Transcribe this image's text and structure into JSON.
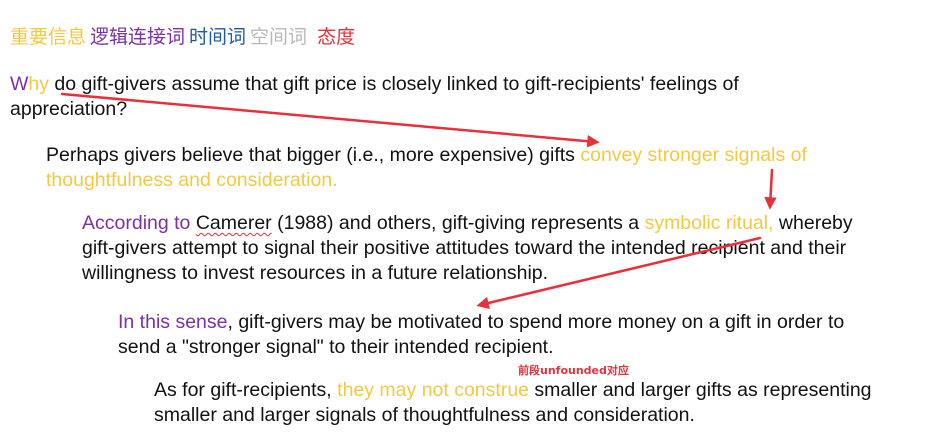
{
  "legend": {
    "important": "重要信息",
    "logic": "逻辑连接词",
    "time": "时间词",
    "empty": "空间词",
    "attitude": "态度"
  },
  "p1": {
    "w": "W",
    "hy": "hy",
    "rest": " do gift-givers assume that gift price is closely linked to gift-recipients' feelings of appreciation?"
  },
  "p2": {
    "a": "Perhaps givers believe that bigger (i.e., more expensive) gifts ",
    "b": "convey stronger signals of thoughtfulness and consideration."
  },
  "p3": {
    "a": "According to",
    "b": " ",
    "c": "Camerer",
    "d": " (1988) and others, gift-giving represents a ",
    "e": "symbolic ritual,",
    "f": " whereby gift-givers attempt to signal their positive attitudes toward the intended recipient and their willingness to invest resources in a future relationship."
  },
  "p4": {
    "a": "In this sense",
    "b": ", gift-givers may be motivated to spend more money on a gift in order to send a \"stronger signal\" to their intended recipient."
  },
  "p5": {
    "a": "As for gift-recipients, ",
    "b": "they may not construe",
    "c": " smaller and larger gifts as representing smaller and larger signals of thoughtfulness and consideration."
  },
  "annotation": {
    "note": "前段unfounded对应"
  },
  "colors": {
    "important": "#f5c842",
    "logic": "#7b2fa8",
    "time": "#1f5a9e",
    "empty": "#b8b8b8",
    "attitude": "#e8303a"
  }
}
